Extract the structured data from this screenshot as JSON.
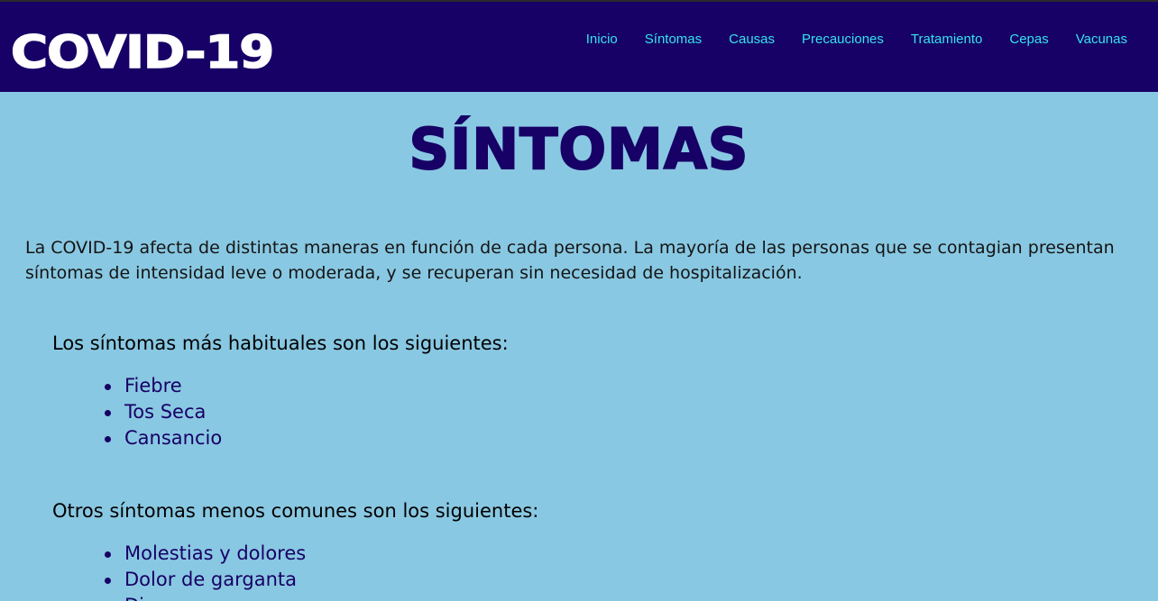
{
  "header": {
    "logo": "COVID-19",
    "nav": [
      "Inicio",
      "Síntomas",
      "Causas",
      "Precauciones",
      "Tratamiento",
      "Cepas",
      "Vacunas"
    ]
  },
  "main": {
    "title": "SÍNTOMAS",
    "intro": "La COVID-19 afecta de distintas maneras en función de cada persona. La mayoría de las personas que se contagian presentan síntomas de intensidad leve o moderada, y se recuperan sin necesidad de hospitalización.",
    "common": {
      "heading": "Los síntomas más habituales son los siguientes:",
      "items": [
        "Fiebre",
        "Tos Seca",
        "Cansancio"
      ]
    },
    "less_common": {
      "heading": "Otros síntomas menos comunes son los siguientes:",
      "items": [
        "Molestias y dolores",
        "Dolor de garganta",
        "Diarrea"
      ]
    }
  },
  "colors": {
    "background": "#89c8e2",
    "header": "#170066",
    "nav_link": "#35e2ee",
    "title": "#170066"
  }
}
